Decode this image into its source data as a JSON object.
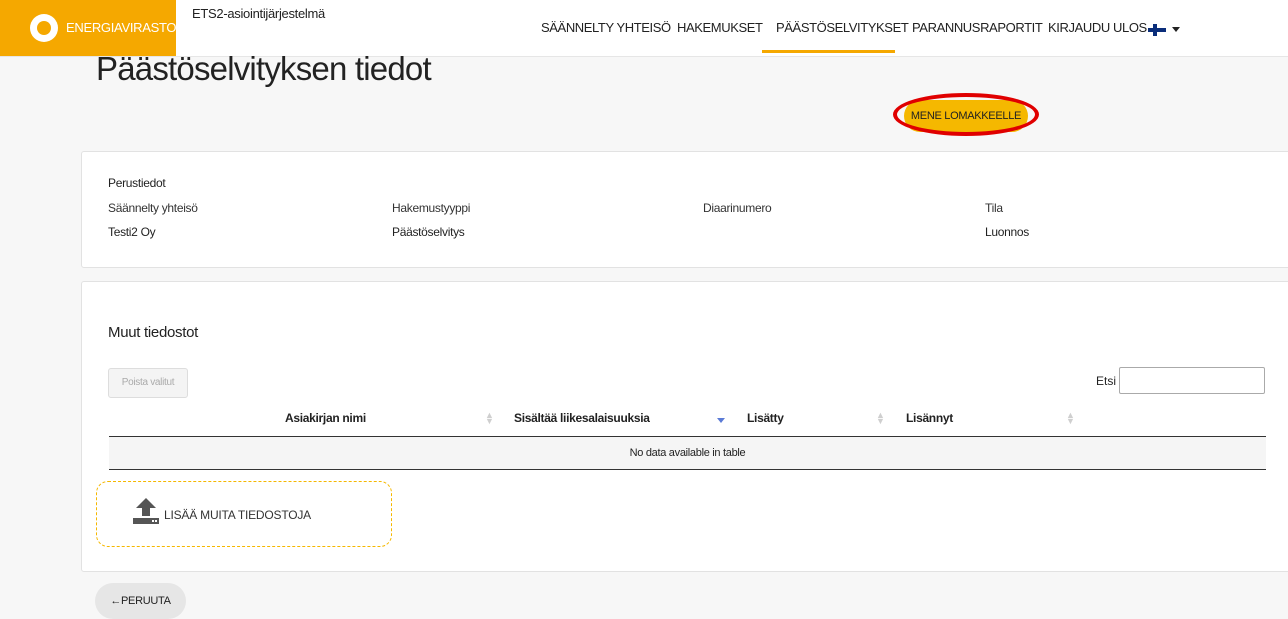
{
  "header": {
    "logo_text": "ENERGIAVIRASTO",
    "system_name": "ETS2-asiointijärjestelmä",
    "nav": [
      {
        "label": "SÄÄNNELTY YHTEISÖ"
      },
      {
        "label": "HAKEMUKSET"
      },
      {
        "label": "PÄÄSTÖSELVITYKSET",
        "active": true
      },
      {
        "label": "PARANNUSRAPORTIT"
      },
      {
        "label": "KIRJAUDU ULOS"
      }
    ],
    "language_flag": "finnish-flag-icon",
    "accent_color": "#f5a800"
  },
  "page": {
    "title": "Päästöselvityksen tiedot",
    "form_button_label": "MENE LOMAKKEELLE",
    "cancel_button_label": "←PERUUTA"
  },
  "basic_info": {
    "section_title": "Perustiedot",
    "fields": [
      {
        "label": "Säännelty yhteisö",
        "value": "Testi2 Oy"
      },
      {
        "label": "Hakemustyyppi",
        "value": "Päästöselvitys"
      },
      {
        "label": "Diaarinumero",
        "value": ""
      },
      {
        "label": "Tila",
        "value": "Luonnos"
      }
    ]
  },
  "files": {
    "section_title": "Muut tiedostot",
    "delete_button_label": "Poista valitut",
    "search_label": "Etsi",
    "search_value": "",
    "columns": [
      "Asiakirjan nimi",
      "Sisältää liikesalaisuuksia",
      "Lisätty",
      "Lisännyt"
    ],
    "empty_text": "No data available in table",
    "upload_label": "LISÄÄ MUITA TIEDOSTOJA"
  }
}
